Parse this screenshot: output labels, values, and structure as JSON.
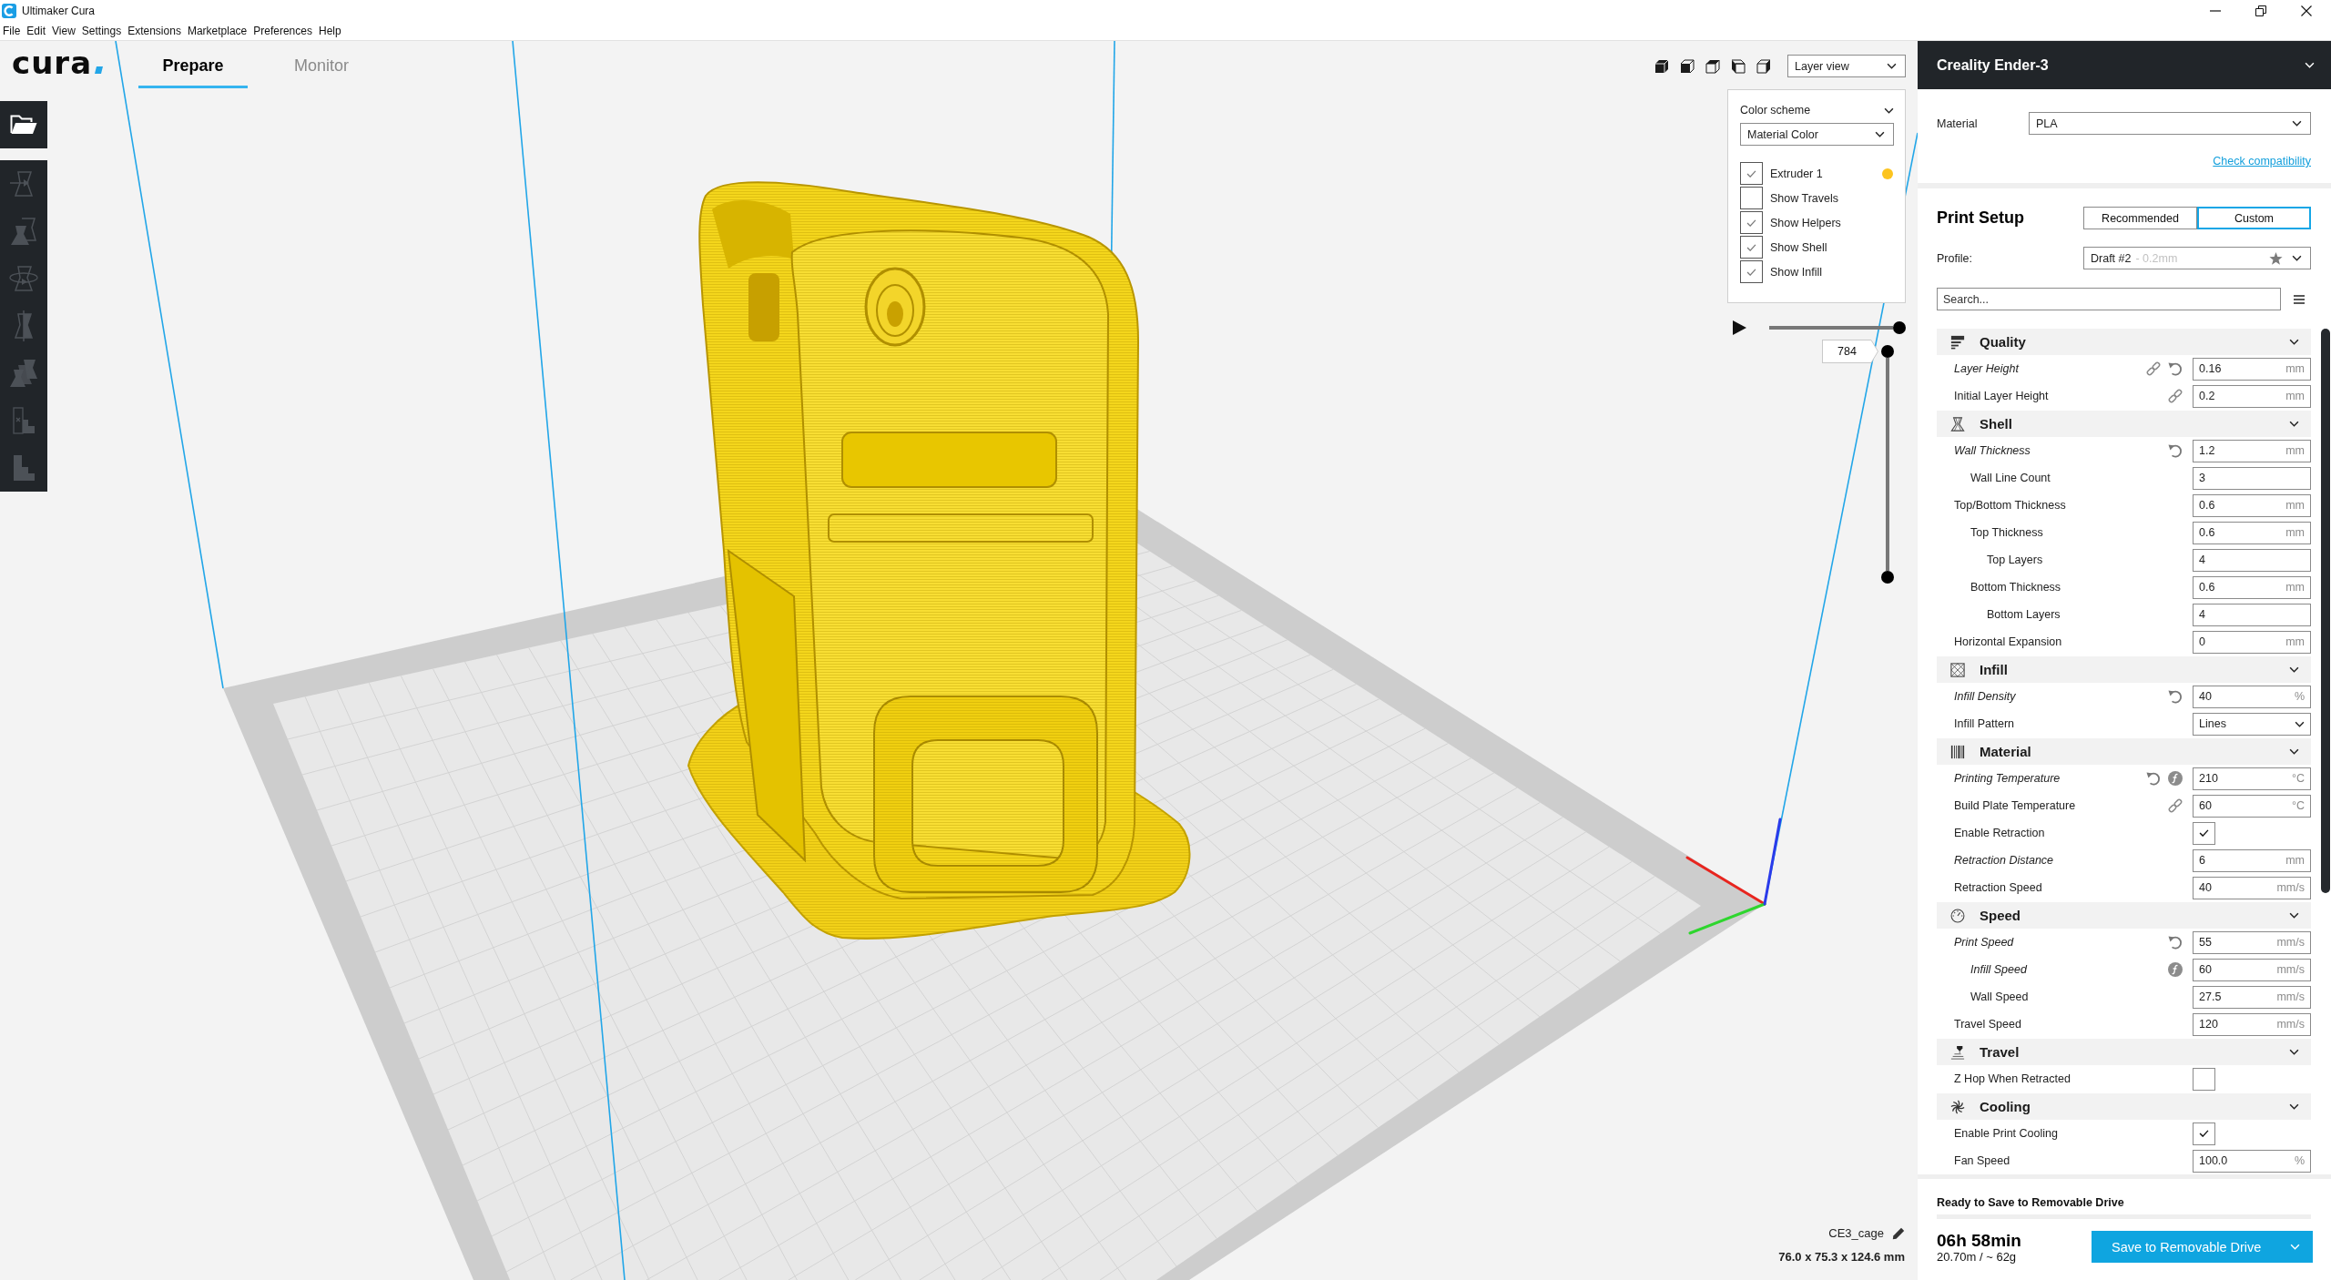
{
  "window": {
    "title": "Ultimaker Cura"
  },
  "menu_bar": [
    "File",
    "Edit",
    "View",
    "Settings",
    "Extensions",
    "Marketplace",
    "Preferences",
    "Help"
  ],
  "header": {
    "logo": "cura",
    "tabs": [
      {
        "label": "Prepare",
        "selected": true
      },
      {
        "label": "Monitor",
        "selected": false
      }
    ]
  },
  "toolbar": {
    "tools": [
      {
        "kind": "move",
        "disabled": true
      },
      {
        "kind": "scale",
        "disabled": true
      },
      {
        "kind": "rotate",
        "disabled": true
      },
      {
        "kind": "mirror",
        "disabled": true
      },
      {
        "kind": "per_model",
        "disabled": true
      },
      {
        "kind": "support_blocker",
        "disabled": true
      },
      {
        "kind": "support",
        "disabled": true
      }
    ]
  },
  "view": {
    "mode": "Layer view",
    "color_scheme_label": "Color scheme",
    "color_scheme": "Material Color",
    "options": [
      {
        "label": "Extruder 1",
        "checked": true,
        "color": "#fcc41f"
      },
      {
        "label": "Show Travels",
        "checked": false
      },
      {
        "label": "Show Helpers",
        "checked": true
      },
      {
        "label": "Show Shell",
        "checked": true
      },
      {
        "label": "Show Infill",
        "checked": true
      }
    ],
    "path_slider": {
      "level": 1
    },
    "layer_slider": {
      "upper": {
        "value": "784",
        "level": 1
      },
      "lower": {
        "level": 0
      }
    }
  },
  "object": {
    "name": "CE3_cage",
    "dimensions": "76.0 x 75.3 x 124.6 mm"
  },
  "printer": {
    "name": "Creality Ender-3",
    "material_label": "Material",
    "material": "PLA",
    "compatibility_link": "Check compatibility"
  },
  "print_setup": {
    "title": "Print Setup",
    "modes": [
      {
        "label": "Recommended",
        "selected": false
      },
      {
        "label": "Custom",
        "selected": true
      }
    ],
    "profile_label": "Profile:",
    "profile": "Draft #2",
    "profile_detail": "- 0.2mm",
    "search": {
      "placeholder": "Search..."
    },
    "categories": [
      {
        "title": "Quality",
        "kind": "quality",
        "expanded": true,
        "settings": [
          {
            "label": "Layer Height",
            "kind": "number",
            "value": "0.16",
            "unit": "mm",
            "overridden": true,
            "linked": true,
            "reset": true
          },
          {
            "label": "Initial Layer Height",
            "kind": "number",
            "value": "0.2",
            "unit": "mm",
            "overridden": false,
            "linked": true
          }
        ]
      },
      {
        "title": "Shell",
        "kind": "shell",
        "expanded": true,
        "settings": [
          {
            "label": "Wall Thickness",
            "kind": "number",
            "value": "1.2",
            "unit": "mm",
            "overridden": true,
            "reset": true,
            "children": [
              {
                "label": "Wall Line Count",
                "kind": "number",
                "value": "3",
                "overridden": false
              }
            ]
          },
          {
            "label": "Top/Bottom Thickness",
            "kind": "number",
            "value": "0.6",
            "unit": "mm",
            "overridden": false,
            "children": [
              {
                "label": "Top Thickness",
                "kind": "number",
                "value": "0.6",
                "unit": "mm",
                "overridden": false,
                "children": [
                  {
                    "label": "Top Layers",
                    "kind": "number",
                    "value": "4",
                    "overridden": false
                  }
                ]
              },
              {
                "label": "Bottom Thickness",
                "kind": "number",
                "value": "0.6",
                "unit": "mm",
                "overridden": false,
                "children": [
                  {
                    "label": "Bottom Layers",
                    "kind": "number",
                    "value": "4",
                    "overridden": false
                  }
                ]
              }
            ]
          },
          {
            "label": "Horizontal Expansion",
            "kind": "number",
            "value": "0",
            "unit": "mm",
            "overridden": false
          }
        ]
      },
      {
        "title": "Infill",
        "kind": "infill",
        "expanded": true,
        "settings": [
          {
            "label": "Infill Density",
            "kind": "number",
            "value": "40",
            "unit": "%",
            "overridden": true,
            "reset": true
          },
          {
            "label": "Infill Pattern",
            "kind": "dropdown",
            "value": "Lines",
            "overridden": false
          }
        ]
      },
      {
        "title": "Material",
        "kind": "material",
        "expanded": true,
        "settings": [
          {
            "label": "Printing Temperature",
            "kind": "number",
            "value": "210",
            "unit": "°C",
            "overridden": true,
            "reset": true,
            "formula": true
          },
          {
            "label": "Build Plate Temperature",
            "kind": "number",
            "value": "60",
            "unit": "°C",
            "overridden": false,
            "linked": true
          },
          {
            "label": "Enable Retraction",
            "kind": "checkbox",
            "checked": true,
            "overridden": false
          },
          {
            "label": "Retraction Distance",
            "kind": "number",
            "value": "6",
            "unit": "mm",
            "overridden": true
          },
          {
            "label": "Retraction Speed",
            "kind": "number",
            "value": "40",
            "unit": "mm/s",
            "overridden": false
          }
        ]
      },
      {
        "title": "Speed",
        "kind": "speed",
        "expanded": true,
        "settings": [
          {
            "label": "Print Speed",
            "kind": "number",
            "value": "55",
            "unit": "mm/s",
            "overridden": true,
            "reset": true,
            "children": [
              {
                "label": "Infill Speed",
                "kind": "number",
                "value": "60",
                "unit": "mm/s",
                "overridden": true,
                "formula": true
              },
              {
                "label": "Wall Speed",
                "kind": "number",
                "value": "27.5",
                "unit": "mm/s",
                "overridden": false
              }
            ]
          },
          {
            "label": "Travel Speed",
            "kind": "number",
            "value": "120",
            "unit": "mm/s",
            "overridden": false
          }
        ]
      },
      {
        "title": "Travel",
        "kind": "travel",
        "expanded": true,
        "settings": [
          {
            "label": "Z Hop When Retracted",
            "kind": "checkbox",
            "checked": false,
            "overridden": false
          }
        ]
      },
      {
        "title": "Cooling",
        "kind": "cooling",
        "expanded": true,
        "settings": [
          {
            "label": "Enable Print Cooling",
            "kind": "checkbox",
            "checked": true,
            "overridden": false
          },
          {
            "label": "Fan Speed",
            "kind": "number",
            "value": "100.0",
            "unit": "%",
            "overridden": false
          }
        ]
      }
    ]
  },
  "output": {
    "status": "Ready to Save to Removable Drive",
    "time": "06h 58min",
    "estimate": "20.70m / ~ 62g",
    "action": "Save to Removable Drive"
  }
}
